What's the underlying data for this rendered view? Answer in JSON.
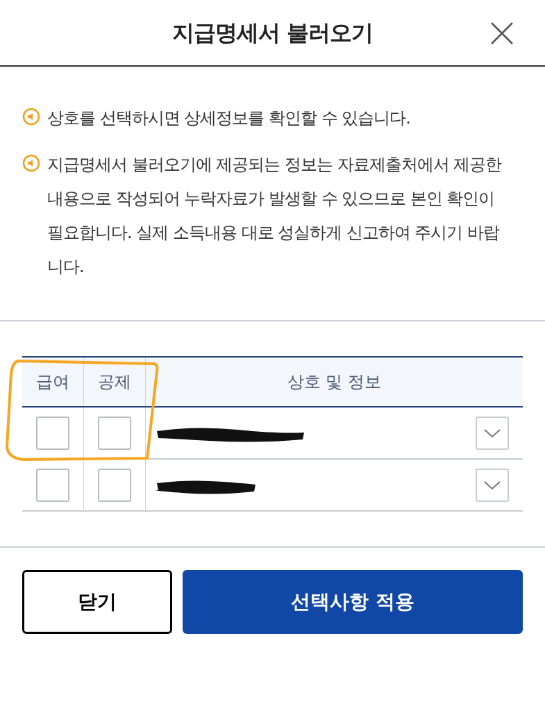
{
  "dialog": {
    "title": "지급명세서 불러오기"
  },
  "notices": [
    "상호를 선택하시면 상세정보를 확인할 수 있습니다.",
    "지급명세서 불러오기에 제공되는 정보는 자료제출처에서 제공한 내용으로 작성되어 누락자료가 발생할 수 있으므로 본인 확인이 필요합니다. 실제 소득내용 대로 성실하게 신고하여 주시기 바랍니다."
  ],
  "table": {
    "columns": [
      "급여",
      "공제",
      "상호 및 정보"
    ],
    "rows": [
      {
        "pay_checked": false,
        "deduction_checked": false,
        "expanded": false
      },
      {
        "pay_checked": false,
        "deduction_checked": false,
        "expanded": false
      }
    ]
  },
  "buttons": [
    {
      "label": "닫기",
      "kind": "secondary"
    },
    {
      "label": "선택사항 적용",
      "kind": "primary"
    }
  ]
}
